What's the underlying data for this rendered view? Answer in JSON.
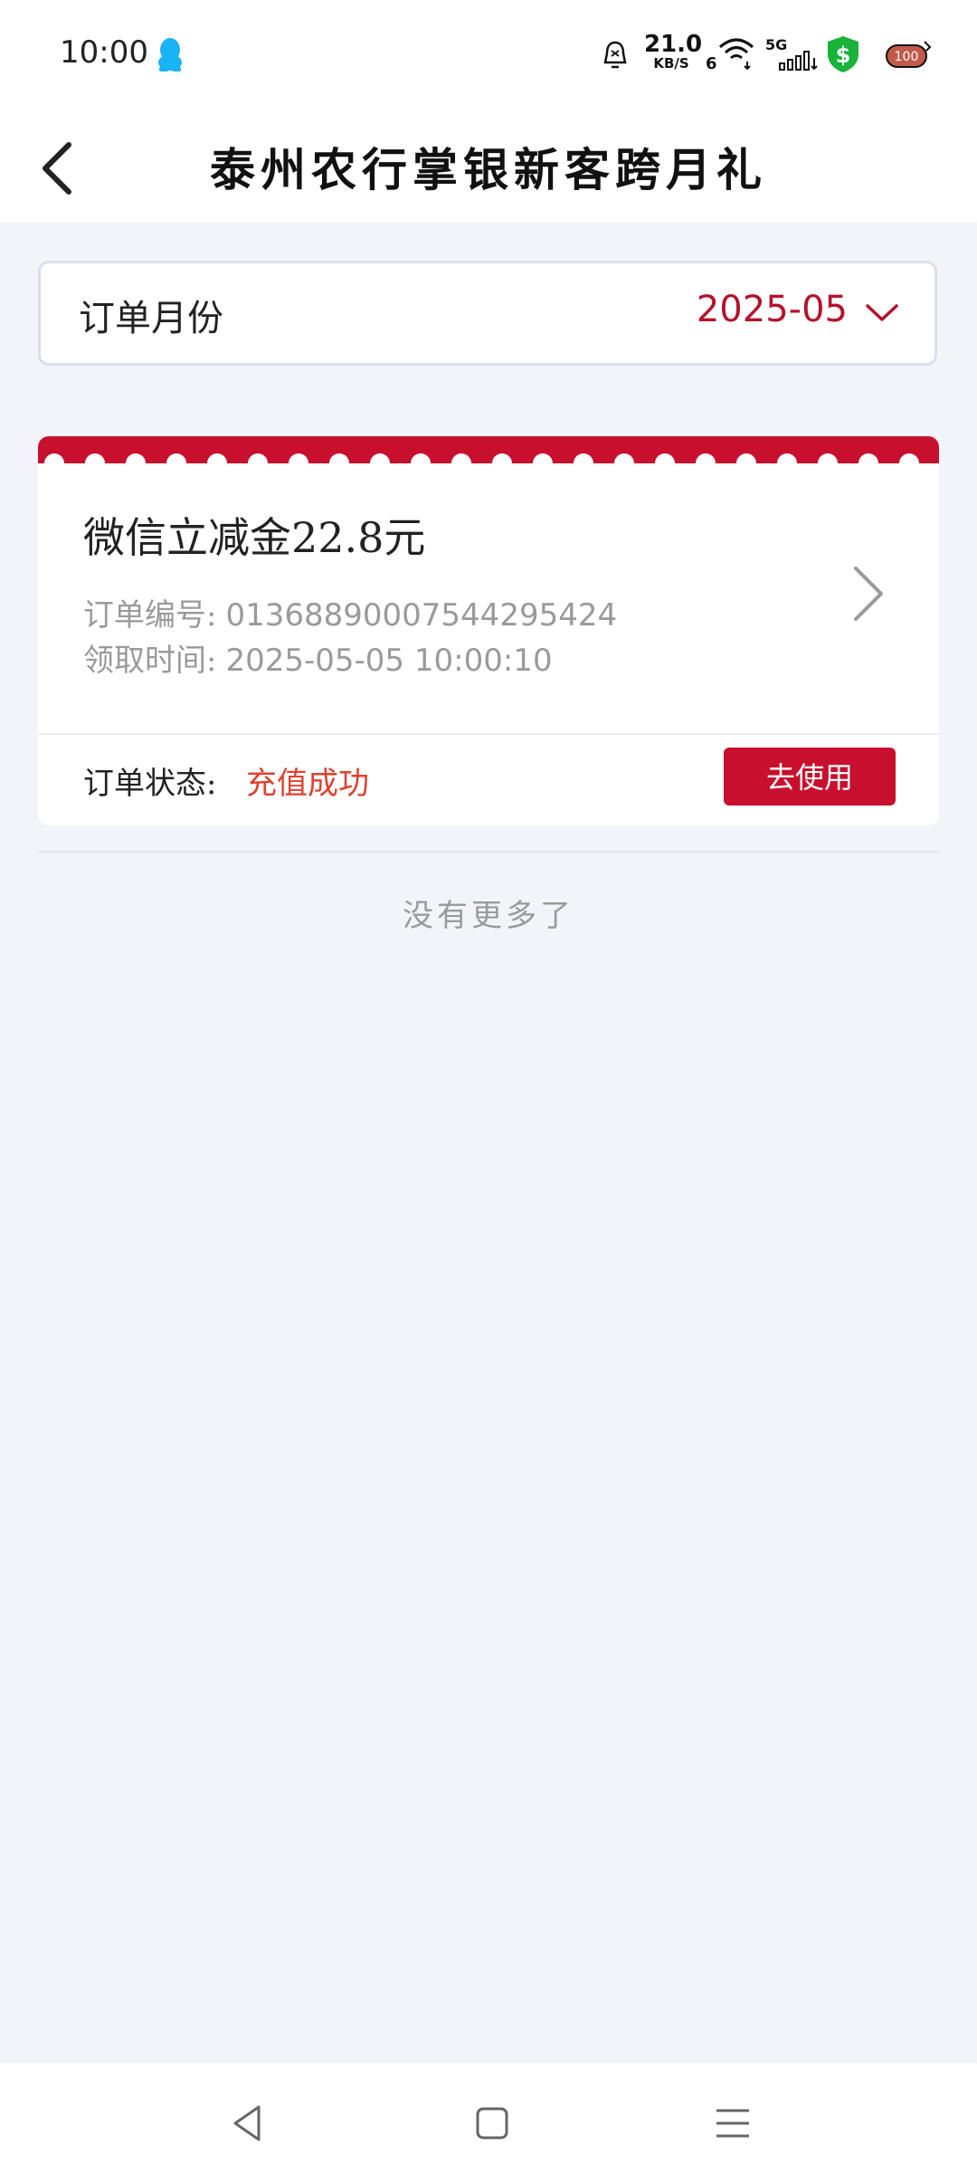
{
  "status_bar": {
    "time": "10:00",
    "net_speed_value": "21.0",
    "net_speed_unit": "KB/S",
    "sim_index": "6",
    "network_type": "5G",
    "battery_level": "100",
    "icons": [
      "qq-icon",
      "alarm-icon",
      "wifi-icon",
      "signal-icon",
      "shield-icon",
      "battery-icon"
    ]
  },
  "header": {
    "title": "泰州农行掌银新客跨月礼",
    "back_icon": "chevron-left-icon"
  },
  "month_selector": {
    "label": "订单月份",
    "value": "2025-05",
    "icon": "chevron-down-icon"
  },
  "order": {
    "title": "微信立减金22.8元",
    "order_no_label": "订单编号:",
    "order_no": "01368890007544295424",
    "time_label": "领取时间:",
    "time": "2025-05-05 10:00:10",
    "status_label": "订单状态:",
    "status": "充值成功",
    "action_label": "去使用"
  },
  "list_footer": {
    "text": "没有更多了"
  },
  "colors": {
    "accent": "#c8102e",
    "status_success": "#e0412f",
    "background": "#f3f4fa"
  }
}
